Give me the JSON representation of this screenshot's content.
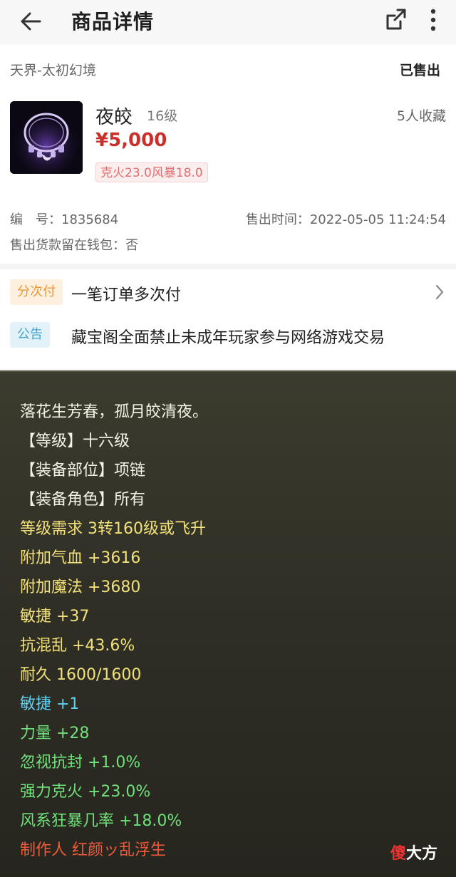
{
  "header": {
    "title": "商品详情"
  },
  "listing": {
    "server": "天界-太初幻境",
    "status": "已售出",
    "item_name": "夜皎",
    "item_level": "16级",
    "favorites": "5人收藏",
    "price": "¥5,000",
    "tag": "克火23.0风暴18.0",
    "id_text": "编　号：1835684",
    "sold_time": "售出时间：2022-05-05 11:24:54",
    "wallet_text": "售出货款留在钱包：否"
  },
  "promo": {
    "installment_badge": "分次付",
    "installment_text": "一笔订单多次付",
    "notice_badge": "公告",
    "notice_text": "藏宝阁全面禁止未成年玩家参与网络游戏交易"
  },
  "tooltip": {
    "lines": [
      {
        "text": "落花生芳春，孤月皎清夜。",
        "color": "white"
      },
      {
        "text": "【等级】十六级",
        "color": "white"
      },
      {
        "text": "【装备部位】项链",
        "color": "white"
      },
      {
        "text": "【装备角色】所有",
        "color": "white"
      },
      {
        "text": "等级需求 3转160级或飞升",
        "color": "yellow"
      },
      {
        "text": "附加气血 +3616",
        "color": "yellow"
      },
      {
        "text": "附加魔法 +3680",
        "color": "yellow"
      },
      {
        "text": "敏捷 +37",
        "color": "yellow"
      },
      {
        "text": "抗混乱 +43.6%",
        "color": "yellow"
      },
      {
        "text": "耐久 1600/1600",
        "color": "yellow"
      },
      {
        "text": "敏捷 +1",
        "color": "cyan"
      },
      {
        "text": "力量 +28",
        "color": "green"
      },
      {
        "text": "忽视抗封 +1.0%",
        "color": "green"
      },
      {
        "text": "强力克火 +23.0%",
        "color": "green"
      },
      {
        "text": "风系狂暴几率 +18.0%",
        "color": "green"
      },
      {
        "text": "制作人 红颜ッ乱浮生",
        "color": "red"
      }
    ]
  },
  "watermark": {
    "first": "傻",
    "rest": "大方"
  },
  "colors": {
    "price": "#c9302c",
    "yellow": "#f2e07a",
    "green": "#6fe07a",
    "cyan": "#5fd0f2",
    "red": "#ef5a3a"
  }
}
